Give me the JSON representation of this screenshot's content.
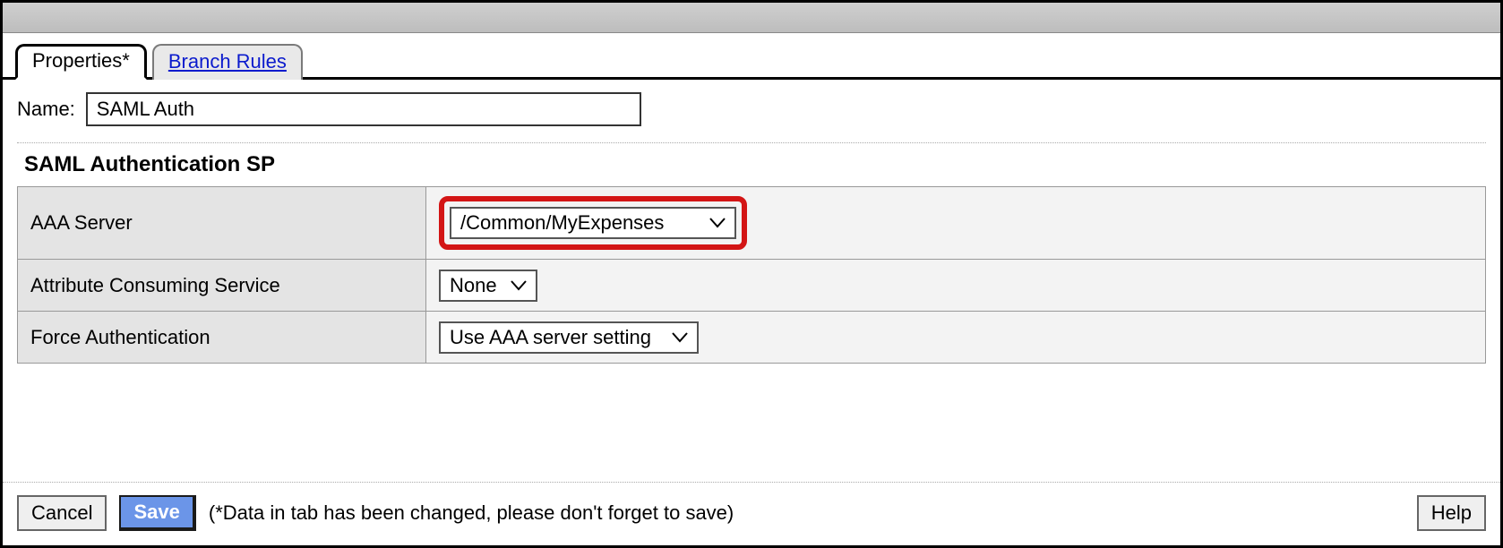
{
  "tabs": {
    "active": "Properties*",
    "inactive": "Branch Rules"
  },
  "nameRow": {
    "label": "Name:",
    "value": "SAML Auth"
  },
  "section": {
    "title": "SAML Authentication SP",
    "rows": {
      "aaa": {
        "label": "AAA Server",
        "value": "/Common/MyExpenses"
      },
      "acs": {
        "label": "Attribute Consuming Service",
        "value": "None"
      },
      "force": {
        "label": "Force Authentication",
        "value": "Use AAA server setting"
      }
    }
  },
  "footer": {
    "cancel": "Cancel",
    "save": "Save",
    "message": "(*Data in tab has been changed, please don't forget to save)",
    "help": "Help"
  }
}
